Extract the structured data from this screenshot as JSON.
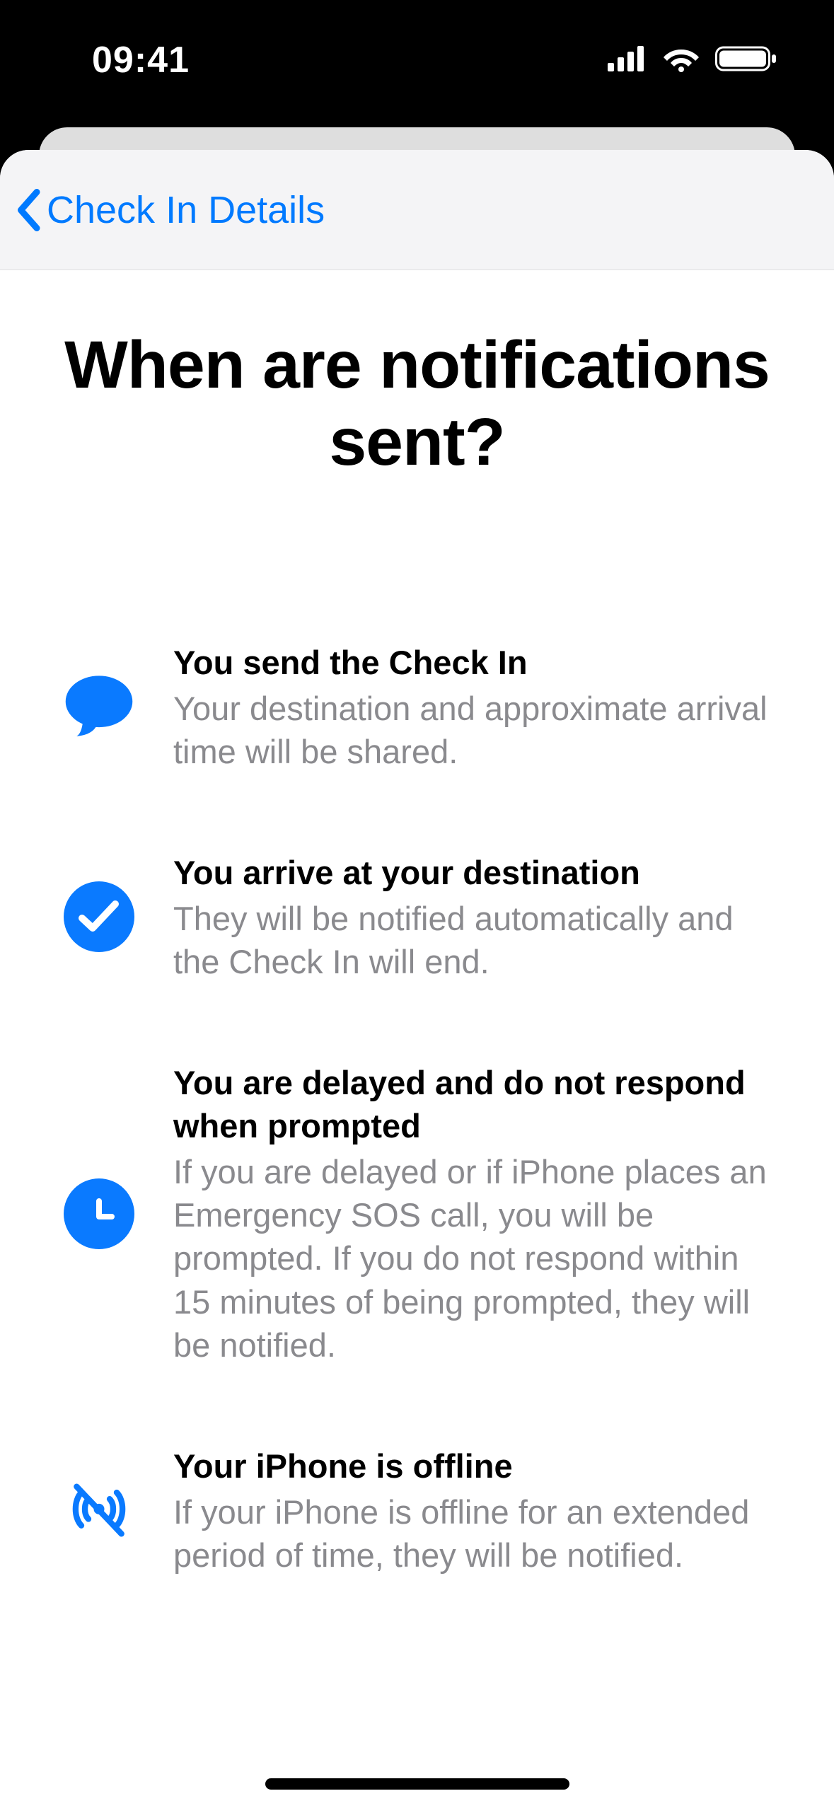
{
  "status": {
    "time": "09:41"
  },
  "nav": {
    "back_label": "Check In Details"
  },
  "header": {
    "title": "When are notifications sent?"
  },
  "items": [
    {
      "icon": "speech-bubble-icon",
      "title": "You send the Check In",
      "desc": "Your destination and approximate arrival time will be shared."
    },
    {
      "icon": "checkmark-circle-icon",
      "title": "You arrive at your destination",
      "desc": "They will be notified automatically and the Check In will end."
    },
    {
      "icon": "clock-icon",
      "title": "You are delayed and do not respond when prompted",
      "desc": "If you are delayed or if iPhone places an Emergency SOS call, you will be prompted. If you do not respond within 15 minutes of being prompted, they will be notified."
    },
    {
      "icon": "antenna-offline-icon",
      "title": "Your iPhone is offline",
      "desc": "If your iPhone is offline for an extended period of time, they will be notified."
    }
  ],
  "colors": {
    "accent": "#007aff",
    "icon_blue": "#0a7aff",
    "text_secondary": "#8a8a8e"
  }
}
